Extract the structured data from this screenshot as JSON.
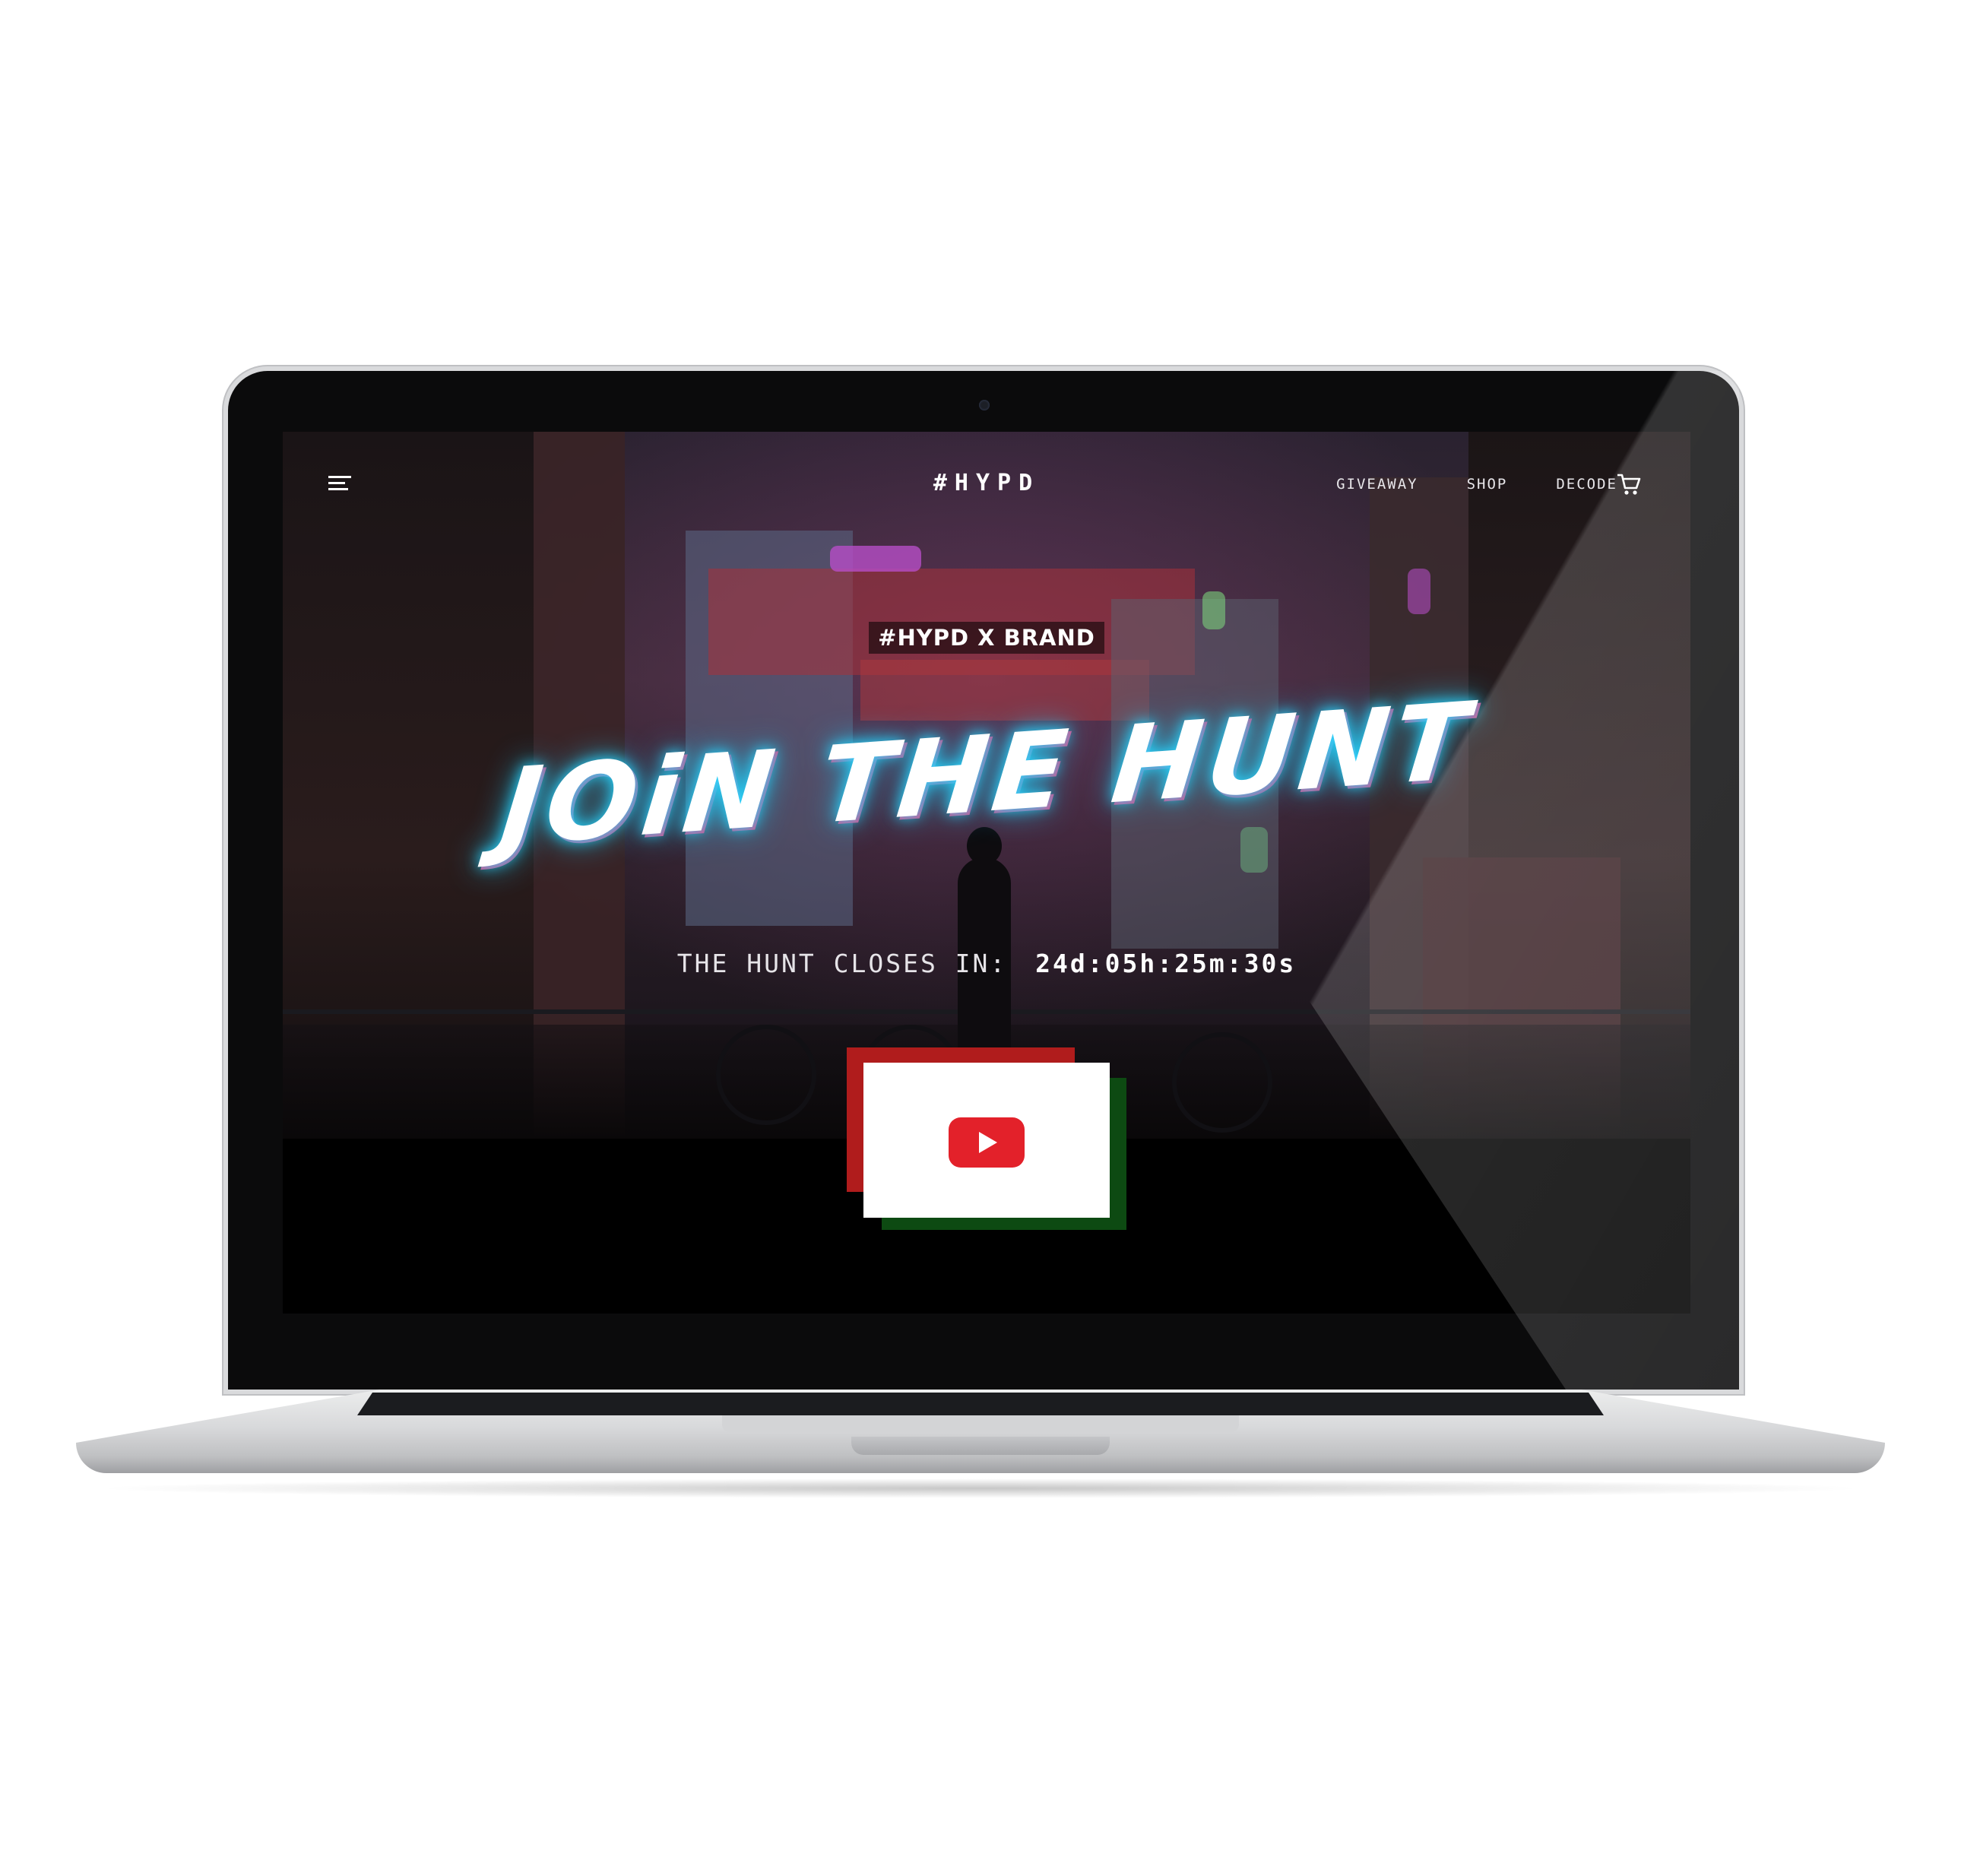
{
  "header": {
    "logo": "#HYPD",
    "nav": [
      {
        "label": "GIVEAWAY"
      },
      {
        "label": "SHOP"
      },
      {
        "label": "DECODE"
      }
    ]
  },
  "hero": {
    "tag": "#HYPD X BRAND",
    "headline": "JOiN THE HUNT",
    "countdown_label": "THE HUNT CLOSES IN:",
    "countdown_value": "24d:05h:25m:30s"
  },
  "video": {
    "icon": "youtube-play-icon"
  },
  "colors": {
    "accent_cyan": "#29d7ff",
    "accent_pink": "#ff3a7a",
    "youtube_red": "#e3212a",
    "frame_red": "#b01c1c",
    "frame_green": "#0d4a12"
  }
}
